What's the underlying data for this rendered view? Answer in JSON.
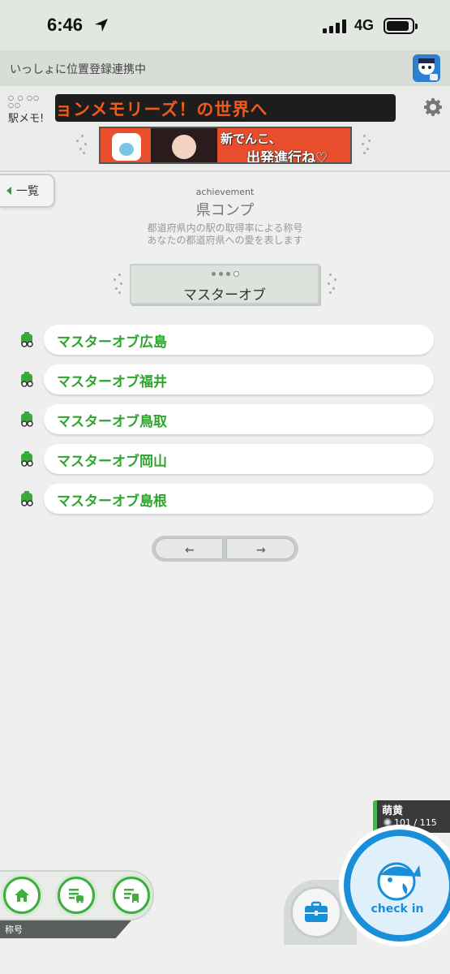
{
  "status_bar": {
    "time": "6:46",
    "network": "4G"
  },
  "link_bar": {
    "text": "いっしょに位置登録連携中"
  },
  "header": {
    "logo_text": "駅メモ!",
    "ticker_text": "ョンメモリーズ！の世界へ",
    "banner_line1": "新でんこ、",
    "banner_line2": "出発進行ね♡"
  },
  "back_tab": {
    "label": "一覧"
  },
  "page": {
    "subtitle": "achievement",
    "title": "県コンプ",
    "description_line1": "都道府県内の駅の取得率による称号",
    "description_line2": "あなたの都道府県への愛を表します"
  },
  "category": {
    "label": "マスターオブ",
    "page_dots": 4,
    "active_dot": 4
  },
  "titles": [
    {
      "label": "マスターオブ広島"
    },
    {
      "label": "マスターオブ福井"
    },
    {
      "label": "マスターオブ鳥取"
    },
    {
      "label": "マスターオブ岡山"
    },
    {
      "label": "マスターオブ島根"
    }
  ],
  "pager": {
    "prev": "←",
    "next": "→"
  },
  "station": {
    "name": "萌黄",
    "count": "101 / 115"
  },
  "bottom_nav": {
    "title_tab": "称号",
    "checkin_label": "check in"
  },
  "colors": {
    "accent_green": "#2ea52e",
    "checkin_blue": "#1a8fd9",
    "ticker_orange": "#f05a1a"
  }
}
